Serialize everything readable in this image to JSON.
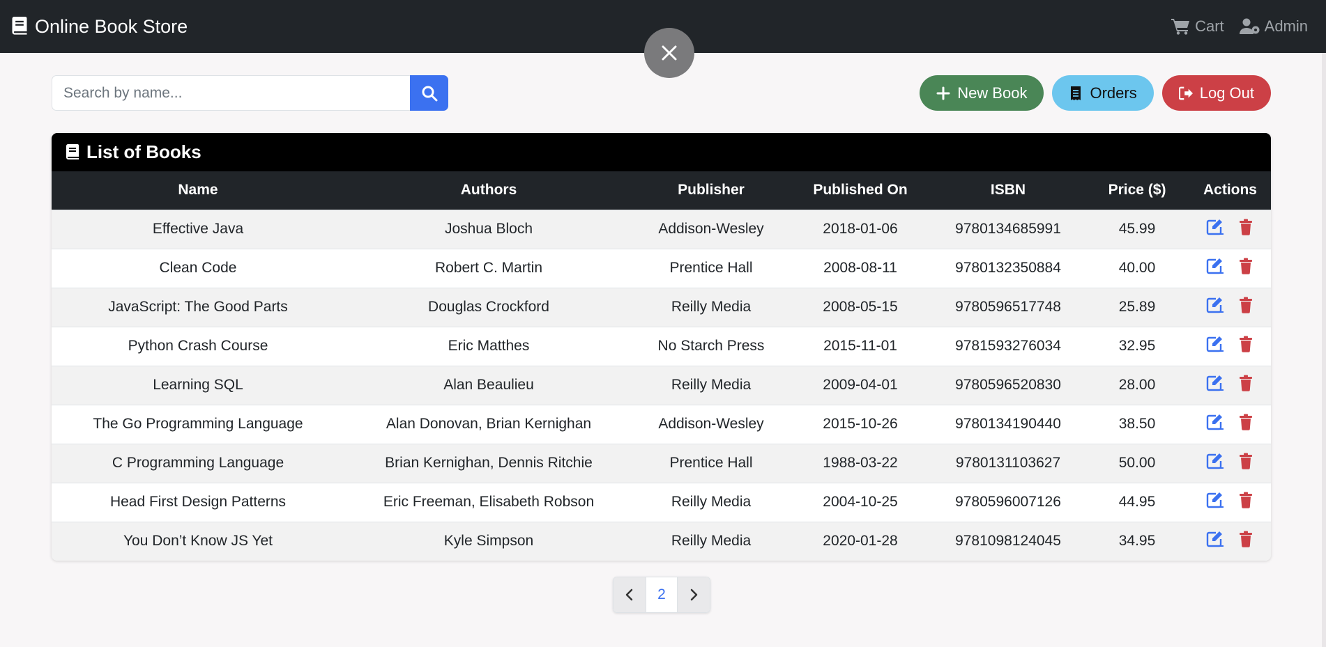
{
  "navbar": {
    "brand": "Online Book Store",
    "cart_label": "Cart",
    "admin_label": "Admin"
  },
  "search": {
    "placeholder": "Search by name...",
    "value": ""
  },
  "toolbar": {
    "new_book_label": "New Book",
    "orders_label": "Orders",
    "logout_label": "Log Out"
  },
  "card": {
    "title": "List of Books"
  },
  "table": {
    "columns": [
      "Name",
      "Authors",
      "Publisher",
      "Published On",
      "ISBN",
      "Price ($)",
      "Actions"
    ],
    "rows": [
      [
        "Effective Java",
        "Joshua Bloch",
        "Addison-Wesley",
        "2018-01-06",
        "9780134685991",
        "45.99"
      ],
      [
        "Clean Code",
        "Robert C. Martin",
        "Prentice Hall",
        "2008-08-11",
        "9780132350884",
        "40.00"
      ],
      [
        "JavaScript: The Good Parts",
        "Douglas Crockford",
        "Reilly Media",
        "2008-05-15",
        "9780596517748",
        "25.89"
      ],
      [
        "Python Crash Course",
        "Eric Matthes",
        "No Starch Press",
        "2015-11-01",
        "9781593276034",
        "32.95"
      ],
      [
        "Learning SQL",
        "Alan Beaulieu",
        "Reilly Media",
        "2009-04-01",
        "9780596520830",
        "28.00"
      ],
      [
        "The Go Programming Language",
        "Alan Donovan, Brian Kernighan",
        "Addison-Wesley",
        "2015-10-26",
        "9780134190440",
        "38.50"
      ],
      [
        "C Programming Language",
        "Brian Kernighan, Dennis Ritchie",
        "Prentice Hall",
        "1988-03-22",
        "9780131103627",
        "50.00"
      ],
      [
        "Head First Design Patterns",
        "Eric Freeman, Elisabeth Robson",
        "Reilly Media",
        "2004-10-25",
        "9780596007126",
        "44.95"
      ],
      [
        "You Don’t Know JS Yet",
        "Kyle Simpson",
        "Reilly Media",
        "2020-01-28",
        "9781098124045",
        "34.95"
      ]
    ]
  },
  "pagination": {
    "current_page": "2"
  },
  "colors": {
    "navbar": "#212529",
    "primary": "#3b71f0",
    "success": "#4a8656",
    "info": "#6cc6ee",
    "danger": "#cc4046"
  },
  "icons": {
    "brand": "book-icon",
    "cart": "cart-icon",
    "admin": "user-gear-icon",
    "close": "close-icon",
    "search": "search-icon",
    "new_book": "plus-icon",
    "orders": "receipt-icon",
    "logout": "logout-icon",
    "edit": "edit-icon",
    "delete": "trash-icon"
  }
}
